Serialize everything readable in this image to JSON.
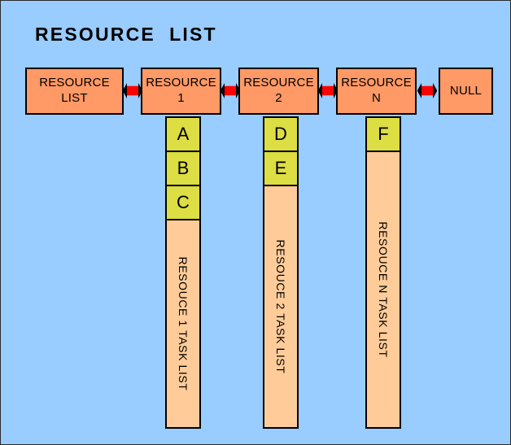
{
  "diagram": {
    "title": "RESOURCE  LIST",
    "colors": {
      "background": "#99ccff",
      "resource_box": "#ff9966",
      "task_cell": "#dddd44",
      "task_column": "#ffcc99",
      "arrow": "#ff0000",
      "outline": "#000000"
    },
    "resource_boxes": [
      {
        "label": "RESOURCE\nLIST",
        "name": "resource-list-head"
      },
      {
        "label": "RESOURCE\n1",
        "name": "resource-1"
      },
      {
        "label": "RESOURCE\n2",
        "name": "resource-2"
      },
      {
        "label": "RESOURCE\nN",
        "name": "resource-n"
      },
      {
        "label": "NULL",
        "name": "null-terminator"
      }
    ],
    "arrows": [
      {
        "name": "link-list-to-1"
      },
      {
        "name": "link-1-to-2"
      },
      {
        "name": "link-2-to-n"
      },
      {
        "name": "link-n-to-null"
      }
    ],
    "task_columns": [
      {
        "name": "resource-1-task-list",
        "tasks": [
          "A",
          "B",
          "C"
        ],
        "label": "RESOUCE 1 TASK LIST"
      },
      {
        "name": "resource-2-task-list",
        "tasks": [
          "D",
          "E"
        ],
        "label": "RESOUCE 2 TASK LIST"
      },
      {
        "name": "resource-n-task-list",
        "tasks": [
          "F"
        ],
        "label": "RESOUCE N TASK LIST"
      }
    ]
  }
}
